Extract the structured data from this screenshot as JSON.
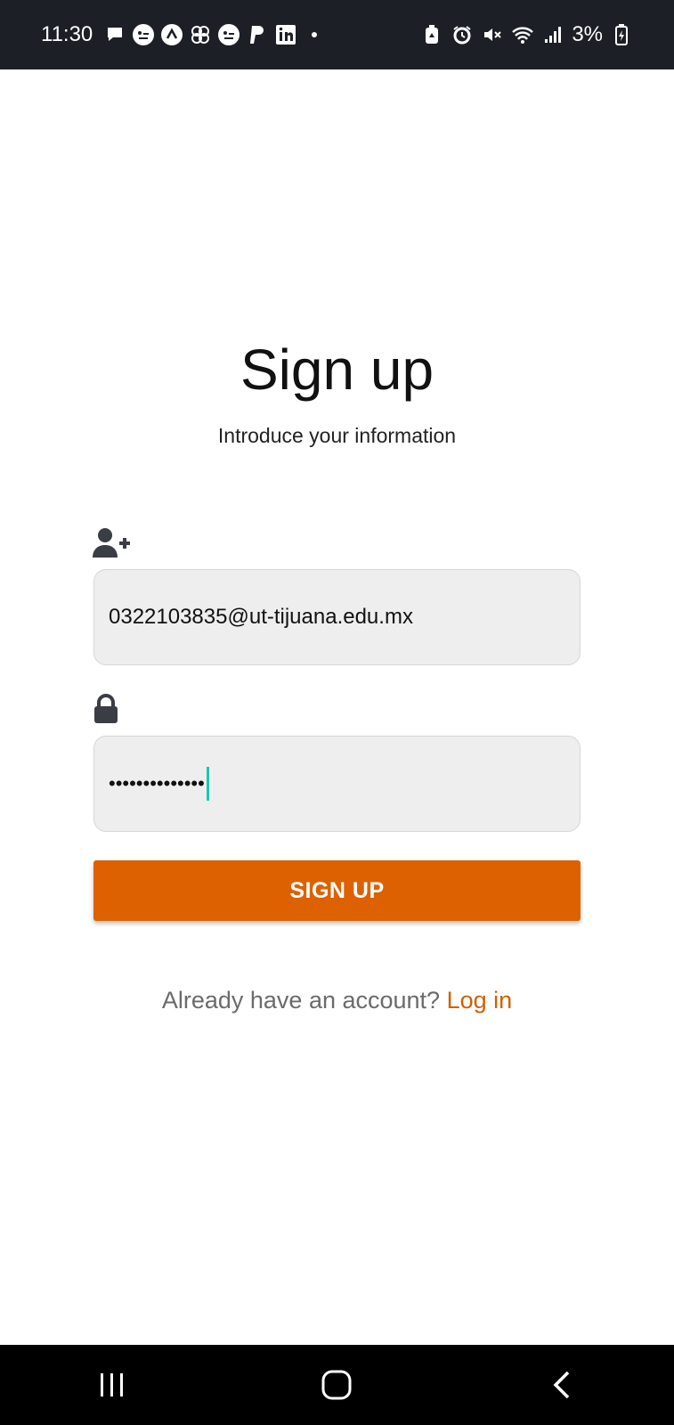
{
  "status_bar": {
    "time": "11:30",
    "battery": "3%",
    "left_icons": [
      "message-icon",
      "chat-icon",
      "arrow-up-icon",
      "pinwheel-icon",
      "chat-icon",
      "paypal-icon",
      "linkedin-icon",
      "dot-icon"
    ],
    "right_icons": [
      "battery-saver-icon",
      "alarm-icon",
      "mute-icon",
      "wifi-icon",
      "signal-icon",
      "battery-icon"
    ]
  },
  "header": {
    "title": "Sign up",
    "subtitle": "Introduce your information"
  },
  "form": {
    "email_icon": "user-plus-icon",
    "email_value": "0322103835@ut-tijuana.edu.mx",
    "password_icon": "lock-icon",
    "password_value": "••••••••••••••",
    "submit_label": "SIGN UP"
  },
  "footer": {
    "prompt": "Already have an account?",
    "link": "Log in"
  },
  "colors": {
    "accent": "#dd6100",
    "link": "#d06000",
    "input_bg": "#eeeeee",
    "status_bar_bg": "#1c1f26"
  },
  "nav": {
    "items": [
      "recents-icon",
      "home-icon",
      "back-icon"
    ]
  }
}
